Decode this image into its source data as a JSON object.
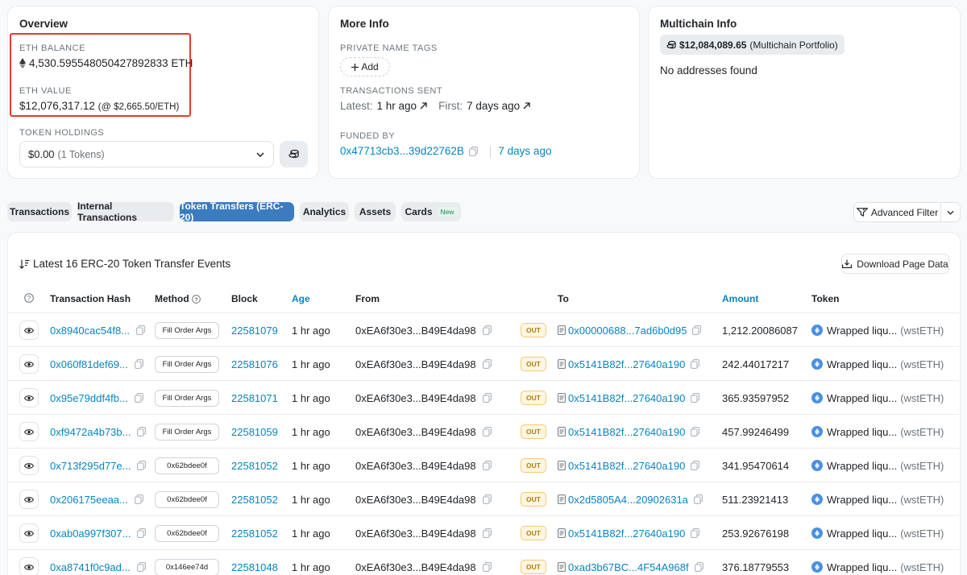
{
  "overview": {
    "title": "Overview",
    "eth_balance_label": "ETH BALANCE",
    "eth_balance": "4,530.595548050427892833 ETH",
    "eth_value_label": "ETH VALUE",
    "eth_value": "$12,076,317.12",
    "eth_value_rate_prefix": "(@ ",
    "eth_value_rate": "$2,665.50/ETH)",
    "token_holdings_label": "TOKEN HOLDINGS",
    "token_holdings_value": "$0.00",
    "token_holdings_count": "(1 Tokens)"
  },
  "more_info": {
    "title": "More Info",
    "private_tags_label": "PRIVATE NAME TAGS",
    "add_label": "Add",
    "tx_sent_label": "TRANSACTIONS SENT",
    "latest_label": "Latest:",
    "latest_value": "1 hr ago",
    "first_label": "First:",
    "first_value": "7 days ago",
    "funded_by_label": "FUNDED BY",
    "funded_by_address": "0x47713cb3...39d22762B",
    "funded_by_age": "7 days ago"
  },
  "multichain": {
    "title": "Multichain Info",
    "portfolio_value": "$12,084,089.65",
    "portfolio_label": "(Multichain Portfolio)",
    "no_addresses": "No addresses found"
  },
  "tabs": [
    {
      "label": "Transactions"
    },
    {
      "label": "Internal Transactions"
    },
    {
      "label": "Token Transfers (ERC-20)"
    },
    {
      "label": "Analytics"
    },
    {
      "label": "Assets"
    },
    {
      "label": "Cards",
      "badge": "New"
    }
  ],
  "advanced_filter_label": "Advanced Filter",
  "table": {
    "summary": "Latest 16 ERC-20 Token Transfer Events",
    "download_label": "Download Page Data",
    "headers": {
      "hash": "Transaction Hash",
      "method": "Method",
      "block": "Block",
      "age": "Age",
      "from": "From",
      "to": "To",
      "amount": "Amount",
      "token": "Token"
    },
    "rows": [
      {
        "hash": "0x8940cac54f8...",
        "method": "Fill Order Args",
        "block": "22581079",
        "age": "1 hr ago",
        "from": "0xEA6f30e3...B49E4da98",
        "direction": "OUT",
        "to": "0x00000688...7ad6b0d95",
        "amount": "1,212.20086087",
        "token": "Wrapped liqu...",
        "symbol": "(wstETH)"
      },
      {
        "hash": "0x060f81def69...",
        "method": "Fill Order Args",
        "block": "22581076",
        "age": "1 hr ago",
        "from": "0xEA6f30e3...B49E4da98",
        "direction": "OUT",
        "to": "0x5141B82f...27640a190",
        "amount": "242.44017217",
        "token": "Wrapped liqu...",
        "symbol": "(wstETH)"
      },
      {
        "hash": "0x95e79ddf4fb...",
        "method": "Fill Order Args",
        "block": "22581071",
        "age": "1 hr ago",
        "from": "0xEA6f30e3...B49E4da98",
        "direction": "OUT",
        "to": "0x5141B82f...27640a190",
        "amount": "365.93597952",
        "token": "Wrapped liqu...",
        "symbol": "(wstETH)"
      },
      {
        "hash": "0xf9472a4b73b...",
        "method": "Fill Order Args",
        "block": "22581059",
        "age": "1 hr ago",
        "from": "0xEA6f30e3...B49E4da98",
        "direction": "OUT",
        "to": "0x5141B82f...27640a190",
        "amount": "457.99246499",
        "token": "Wrapped liqu...",
        "symbol": "(wstETH)"
      },
      {
        "hash": "0x713f295d77e...",
        "method": "0x62bdee0f",
        "block": "22581052",
        "age": "1 hr ago",
        "from": "0xEA6f30e3...B49E4da98",
        "direction": "OUT",
        "to": "0x5141B82f...27640a190",
        "amount": "341.95470614",
        "token": "Wrapped liqu...",
        "symbol": "(wstETH)"
      },
      {
        "hash": "0x206175eeaa...",
        "method": "0x62bdee0f",
        "block": "22581052",
        "age": "1 hr ago",
        "from": "0xEA6f30e3...B49E4da98",
        "direction": "OUT",
        "to": "0x2d5805A4...20902631a",
        "amount": "511.23921413",
        "token": "Wrapped liqu...",
        "symbol": "(wstETH)"
      },
      {
        "hash": "0xab0a997f307...",
        "method": "0x62bdee0f",
        "block": "22581052",
        "age": "1 hr ago",
        "from": "0xEA6f30e3...B49E4da98",
        "direction": "OUT",
        "to": "0x5141B82f...27640a190",
        "amount": "253.92676198",
        "token": "Wrapped liqu...",
        "symbol": "(wstETH)"
      },
      {
        "hash": "0xa8741f0c9ad...",
        "method": "0x146ee74d",
        "block": "22581048",
        "age": "1 hr ago",
        "from": "0xEA6f30e3...B49E4da98",
        "direction": "OUT",
        "to": "0xad3b67BC...4F54A968f",
        "amount": "376.18779553",
        "token": "Wrapped liqu...",
        "symbol": "(wstETH)"
      }
    ]
  },
  "colors": {
    "link": "#0784c3",
    "tab_active": "#3b7bbf",
    "highlight_border": "#e03c31",
    "out_badge": "#b47d00"
  }
}
